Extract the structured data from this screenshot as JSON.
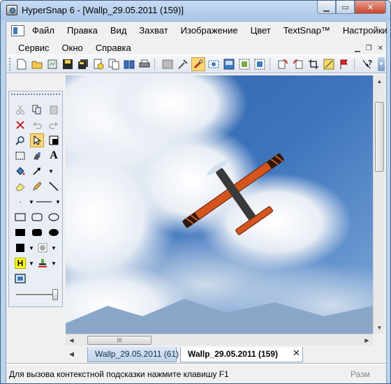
{
  "window": {
    "title": "HyperSnap 6 - [Wallp_29.05.2011 (159)]"
  },
  "menu": {
    "row1": [
      "Файл",
      "Правка",
      "Вид",
      "Захват",
      "Изображение",
      "Цвет",
      "TextSnap™",
      "Настройки"
    ],
    "row2": [
      "Сервис",
      "Окно",
      "Справка"
    ]
  },
  "tabs": [
    {
      "label": "Wallp_29.05.2011 (61)"
    },
    {
      "label": "Wallp_29.05.2011 (159)"
    }
  ],
  "status": {
    "hint": "Для вызова контекстной подсказки нажмите клавишу F1",
    "right": "Разм"
  },
  "scroll": {
    "h_thumb_label": "III"
  },
  "toolbox": {
    "text_tool_glyph": "A",
    "highlight_glyph": "H"
  },
  "canvas": {
    "sky_color": "#3e75bd",
    "plane_color": "#d5541c"
  }
}
